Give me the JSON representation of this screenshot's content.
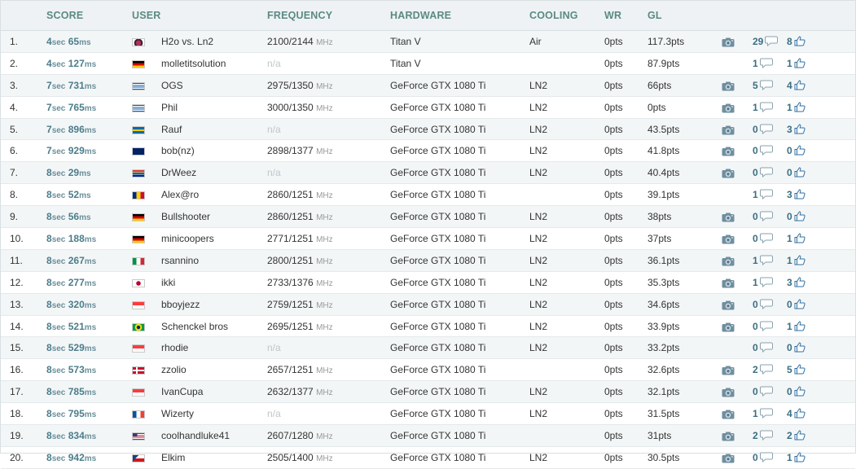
{
  "header": {
    "score": "SCORE",
    "user": "USER",
    "frequency": "FREQUENCY",
    "hardware": "HARDWARE",
    "cooling": "COOLING",
    "wr": "WR",
    "gl": "GL"
  },
  "units": {
    "sec": "sec",
    "ms": "ms",
    "mhz": "MHz"
  },
  "rows": [
    {
      "rank": "1.",
      "sec": "4",
      "ms": "65",
      "flag": "custom",
      "user": "H2o vs. Ln2",
      "freq": "2100/2144",
      "hw": "Titan V",
      "cooling": "Air",
      "wr": "0pts",
      "gl": "117.3pts",
      "photo": true,
      "comments": "29",
      "likes": "8"
    },
    {
      "rank": "2.",
      "sec": "4",
      "ms": "127",
      "flag": "de",
      "user": "molletitsolution",
      "freq": "n/a",
      "hw": "Titan V",
      "cooling": "",
      "wr": "0pts",
      "gl": "87.9pts",
      "photo": false,
      "comments": "1",
      "likes": "1"
    },
    {
      "rank": "3.",
      "sec": "7",
      "ms": "731",
      "flag": "gr",
      "user": "OGS",
      "freq": "2975/1350",
      "hw": "GeForce GTX 1080 Ti",
      "cooling": "LN2",
      "wr": "0pts",
      "gl": "66pts",
      "photo": true,
      "comments": "5",
      "likes": "4"
    },
    {
      "rank": "4.",
      "sec": "7",
      "ms": "765",
      "flag": "gr",
      "user": "Phil",
      "freq": "3000/1350",
      "hw": "GeForce GTX 1080 Ti",
      "cooling": "LN2",
      "wr": "0pts",
      "gl": "0pts",
      "photo": true,
      "comments": "1",
      "likes": "1"
    },
    {
      "rank": "5.",
      "sec": "7",
      "ms": "896",
      "flag": "se",
      "user": "Rauf",
      "freq": "n/a",
      "hw": "GeForce GTX 1080 Ti",
      "cooling": "LN2",
      "wr": "0pts",
      "gl": "43.5pts",
      "photo": true,
      "comments": "0",
      "likes": "3"
    },
    {
      "rank": "6.",
      "sec": "7",
      "ms": "929",
      "flag": "au",
      "user": "bob(nz)",
      "freq": "2898/1377",
      "hw": "GeForce GTX 1080 Ti",
      "cooling": "LN2",
      "wr": "0pts",
      "gl": "41.8pts",
      "photo": true,
      "comments": "0",
      "likes": "0"
    },
    {
      "rank": "7.",
      "sec": "8",
      "ms": "29",
      "flag": "za",
      "user": "DrWeez",
      "freq": "n/a",
      "hw": "GeForce GTX 1080 Ti",
      "cooling": "LN2",
      "wr": "0pts",
      "gl": "40.4pts",
      "photo": true,
      "comments": "0",
      "likes": "0"
    },
    {
      "rank": "8.",
      "sec": "8",
      "ms": "52",
      "flag": "ro",
      "user": "Alex@ro",
      "freq": "2860/1251",
      "hw": "GeForce GTX 1080 Ti",
      "cooling": "",
      "wr": "0pts",
      "gl": "39.1pts",
      "photo": false,
      "comments": "1",
      "likes": "3"
    },
    {
      "rank": "9.",
      "sec": "8",
      "ms": "56",
      "flag": "de",
      "user": "Bullshooter",
      "freq": "2860/1251",
      "hw": "GeForce GTX 1080 Ti",
      "cooling": "LN2",
      "wr": "0pts",
      "gl": "38pts",
      "photo": true,
      "comments": "0",
      "likes": "0"
    },
    {
      "rank": "10.",
      "sec": "8",
      "ms": "188",
      "flag": "de",
      "user": "minicoopers",
      "freq": "2771/1251",
      "hw": "GeForce GTX 1080 Ti",
      "cooling": "LN2",
      "wr": "0pts",
      "gl": "37pts",
      "photo": true,
      "comments": "0",
      "likes": "1"
    },
    {
      "rank": "11.",
      "sec": "8",
      "ms": "267",
      "flag": "it",
      "user": "rsannino",
      "freq": "2800/1251",
      "hw": "GeForce GTX 1080 Ti",
      "cooling": "LN2",
      "wr": "0pts",
      "gl": "36.1pts",
      "photo": true,
      "comments": "1",
      "likes": "1"
    },
    {
      "rank": "12.",
      "sec": "8",
      "ms": "277",
      "flag": "jp",
      "user": "ikki",
      "freq": "2733/1376",
      "hw": "GeForce GTX 1080 Ti",
      "cooling": "LN2",
      "wr": "0pts",
      "gl": "35.3pts",
      "photo": true,
      "comments": "1",
      "likes": "3"
    },
    {
      "rank": "13.",
      "sec": "8",
      "ms": "320",
      "flag": "id",
      "user": "bboyjezz",
      "freq": "2759/1251",
      "hw": "GeForce GTX 1080 Ti",
      "cooling": "LN2",
      "wr": "0pts",
      "gl": "34.6pts",
      "photo": true,
      "comments": "0",
      "likes": "0"
    },
    {
      "rank": "14.",
      "sec": "8",
      "ms": "521",
      "flag": "br",
      "user": "Schenckel bros",
      "freq": "2695/1251",
      "hw": "GeForce GTX 1080 Ti",
      "cooling": "LN2",
      "wr": "0pts",
      "gl": "33.9pts",
      "photo": true,
      "comments": "0",
      "likes": "1"
    },
    {
      "rank": "15.",
      "sec": "8",
      "ms": "529",
      "flag": "id",
      "user": "rhodie",
      "freq": "n/a",
      "hw": "GeForce GTX 1080 Ti",
      "cooling": "LN2",
      "wr": "0pts",
      "gl": "33.2pts",
      "photo": false,
      "comments": "0",
      "likes": "0"
    },
    {
      "rank": "16.",
      "sec": "8",
      "ms": "573",
      "flag": "dk",
      "user": "zzolio",
      "freq": "2657/1251",
      "hw": "GeForce GTX 1080 Ti",
      "cooling": "",
      "wr": "0pts",
      "gl": "32.6pts",
      "photo": true,
      "comments": "2",
      "likes": "5"
    },
    {
      "rank": "17.",
      "sec": "8",
      "ms": "785",
      "flag": "id",
      "user": "IvanCupa",
      "freq": "2632/1377",
      "hw": "GeForce GTX 1080 Ti",
      "cooling": "LN2",
      "wr": "0pts",
      "gl": "32.1pts",
      "photo": true,
      "comments": "0",
      "likes": "0"
    },
    {
      "rank": "18.",
      "sec": "8",
      "ms": "795",
      "flag": "fr",
      "user": "Wizerty",
      "freq": "n/a",
      "hw": "GeForce GTX 1080 Ti",
      "cooling": "LN2",
      "wr": "0pts",
      "gl": "31.5pts",
      "photo": true,
      "comments": "1",
      "likes": "4"
    },
    {
      "rank": "19.",
      "sec": "8",
      "ms": "834",
      "flag": "us",
      "user": "coolhandluke41",
      "freq": "2607/1280",
      "hw": "GeForce GTX 1080 Ti",
      "cooling": "",
      "wr": "0pts",
      "gl": "31pts",
      "photo": true,
      "comments": "2",
      "likes": "2"
    },
    {
      "rank": "20.",
      "sec": "8",
      "ms": "942",
      "flag": "cz",
      "user": "Elkim",
      "freq": "2505/1400",
      "hw": "GeForce GTX 1080 Ti",
      "cooling": "LN2",
      "wr": "0pts",
      "gl": "30.5pts",
      "photo": true,
      "comments": "0",
      "likes": "1"
    }
  ],
  "colors": {
    "accent": "#5b8a83",
    "link": "#3a6e82",
    "alt_row": "#f3f6f7",
    "header_bg": "#eef2f4"
  }
}
